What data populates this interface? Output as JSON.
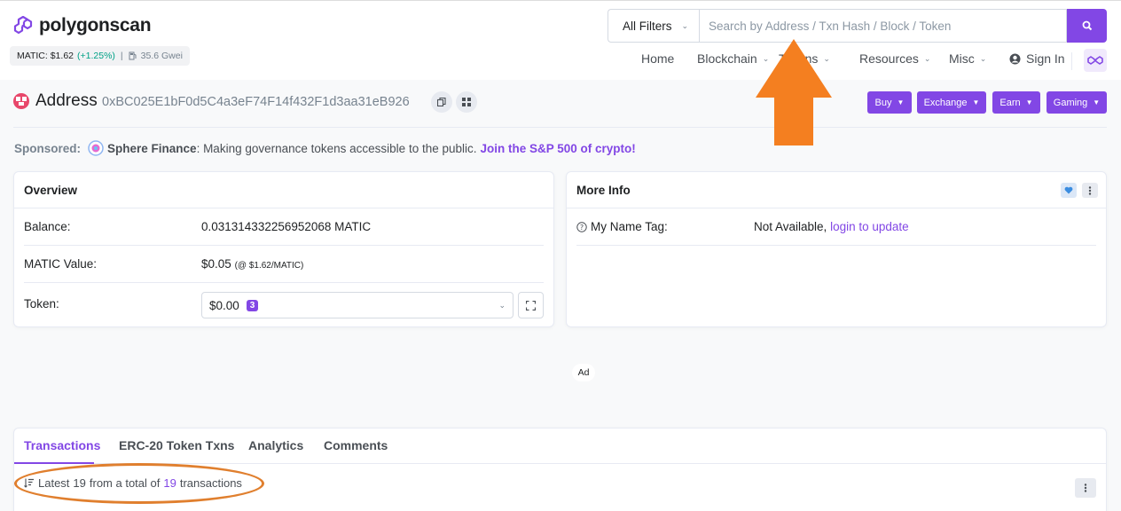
{
  "header": {
    "logo_text": "polygonscan",
    "price_label": "MATIC: $1.62",
    "price_change": "(+1.25%)",
    "separator": "|",
    "gas": "35.6 Gwei",
    "filter_label": "All Filters",
    "search_placeholder": "Search by Address / Txn Hash / Block / Token"
  },
  "nav": {
    "items": [
      "Home",
      "Blockchain",
      "Tokens",
      "Resources",
      "Misc"
    ],
    "sign_in": "Sign In"
  },
  "address": {
    "title": "Address",
    "hash": "0xBC025E1bF0d5C4a3eF74F14f432F1d3aa31eB926",
    "buttons": [
      "Buy",
      "Exchange",
      "Earn",
      "Gaming"
    ]
  },
  "sponsor": {
    "label": "Sponsored:",
    "name": "Sphere Finance",
    "text": ": Making governance tokens accessible to the public.",
    "link": "Join the S&P 500 of crypto!"
  },
  "overview": {
    "title": "Overview",
    "balance_label": "Balance:",
    "balance_value": "0.031314332256952068 MATIC",
    "value_label": "MATIC Value:",
    "value_amount": "$0.05",
    "value_note": "(@ $1.62/MATIC)",
    "token_label": "Token:",
    "token_value": "$0.00",
    "token_count": "3"
  },
  "more_info": {
    "title": "More Info",
    "name_tag_label": "My Name Tag:",
    "name_tag_value": "Not Available,",
    "name_tag_link": "login to update"
  },
  "ad_label": "Ad",
  "tabs": {
    "items": [
      "Transactions",
      "ERC-20 Token Txns",
      "Analytics",
      "Comments"
    ],
    "summary_prefix": "Latest",
    "summary_latest": "19",
    "summary_mid": "from a total of",
    "summary_total": "19",
    "summary_suffix": "transactions"
  },
  "colors": {
    "brand": "#8247e5",
    "positive": "#00a186",
    "annotation": "#f47f20"
  }
}
